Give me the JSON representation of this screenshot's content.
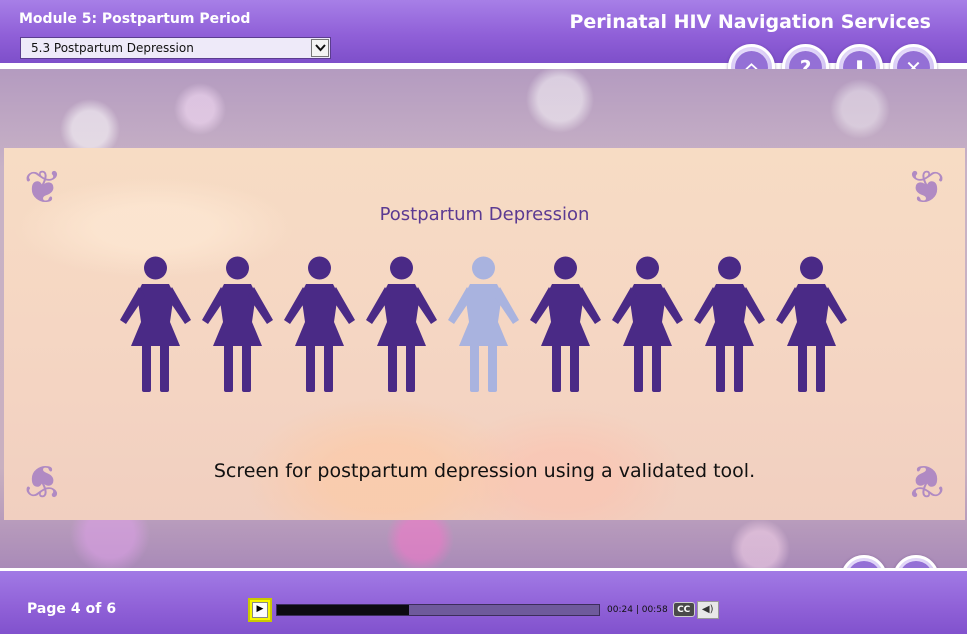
{
  "header": {
    "module_title": "Module 5: Postpartum Period",
    "app_title": "Perinatal HIV Navigation Services",
    "section_select": {
      "value": "5.3 Postpartum Depression"
    },
    "buttons": [
      {
        "name": "home-button",
        "icon": "home-icon",
        "glyph": "⌂"
      },
      {
        "name": "help-button",
        "icon": "question-icon",
        "glyph": "?"
      },
      {
        "name": "download-button",
        "icon": "download-icon",
        "glyph": "⬇"
      },
      {
        "name": "close-button",
        "icon": "close-icon",
        "glyph": "✕"
      }
    ]
  },
  "slide": {
    "title": "Postpartum Depression",
    "caption": "Screen for postpartum depression using a validated tool.",
    "figures": {
      "count": 9,
      "highlighted_index": 4,
      "color": "#4a2a86",
      "highlight_color": "#a9b3df"
    }
  },
  "nav": {
    "prev_glyph": "❮",
    "next_glyph": "❯"
  },
  "footer": {
    "page_label": "Page",
    "page_current": "4",
    "page_of": "of",
    "page_total": "6",
    "progress": 0.41,
    "time_current": "00:24",
    "time_separator": "|",
    "time_total": "00:58",
    "cc_label": "CC",
    "play_glyph": "▶",
    "volume_glyph": "◀)"
  },
  "colors": {
    "header_purple": "#9060d8",
    "slide_bg": "#f6d8c3",
    "title_purple": "#5b3a92",
    "play_yellow": "#f8f600"
  }
}
